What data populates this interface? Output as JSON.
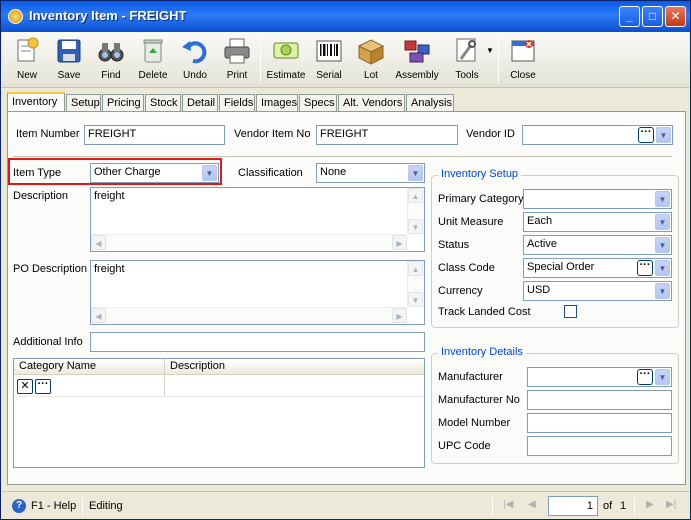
{
  "window": {
    "title": "Inventory Item - FREIGHT",
    "controls": {
      "minimize": "_",
      "maximize": "□",
      "close": "✕"
    }
  },
  "toolbar": {
    "buttons": [
      {
        "label": "New",
        "icon": "new-document-icon"
      },
      {
        "label": "Save",
        "icon": "floppy-disk-icon"
      },
      {
        "label": "Find",
        "icon": "binoculars-icon"
      },
      {
        "label": "Delete",
        "icon": "recycle-bin-icon"
      },
      {
        "label": "Undo",
        "icon": "undo-arrow-icon"
      },
      {
        "label": "Print",
        "icon": "printer-icon"
      },
      {
        "label": "Estimate",
        "icon": "estimate-icon"
      },
      {
        "label": "Serial",
        "icon": "barcode-icon"
      },
      {
        "label": "Lot",
        "icon": "box-icon"
      },
      {
        "label": "Assembly",
        "icon": "assembly-icon"
      },
      {
        "label": "Tools",
        "icon": "tools-icon"
      },
      {
        "label": "Close",
        "icon": "close-window-icon"
      }
    ]
  },
  "tabs": [
    "Inventory",
    "Setup",
    "Pricing",
    "Stock",
    "Detail",
    "Fields",
    "Images",
    "Specs",
    "Alt. Vendors",
    "Analysis"
  ],
  "active_tab": "Inventory",
  "form": {
    "item_number_label": "Item Number",
    "item_number": "FREIGHT",
    "vendor_item_no_label": "Vendor Item No",
    "vendor_item_no": "FREIGHT",
    "vendor_id_label": "Vendor ID",
    "vendor_id": "",
    "item_type_label": "Item Type",
    "item_type": "Other Charge",
    "classification_label": "Classification",
    "classification": "None",
    "description_label": "Description",
    "description": "freight",
    "po_description_label": "PO Description",
    "po_description": "freight",
    "additional_info_label": "Additional Info",
    "additional_info": ""
  },
  "category_grid": {
    "columns": [
      "Category Name",
      "Description"
    ],
    "row_delete_btn": "✕",
    "row_lookup_btn": "···"
  },
  "inventory_setup": {
    "title": "Inventory Setup",
    "primary_category_label": "Primary Category",
    "primary_category": "",
    "unit_measure_label": "Unit Measure",
    "unit_measure": "Each",
    "status_label": "Status",
    "status": "Active",
    "class_code_label": "Class Code",
    "class_code": "Special Order",
    "currency_label": "Currency",
    "currency": "USD",
    "track_landed_cost_label": "Track Landed Cost",
    "track_landed_cost": false
  },
  "inventory_details": {
    "title": "Inventory Details",
    "manufacturer_label": "Manufacturer",
    "manufacturer": "",
    "manufacturer_no_label": "Manufacturer No",
    "manufacturer_no": "",
    "model_number_label": "Model Number",
    "model_number": "",
    "upc_code_label": "UPC Code",
    "upc_code": ""
  },
  "statusbar": {
    "help": "F1 - Help",
    "status": "Editing",
    "page": "1",
    "of_label": "of",
    "total_pages": "1"
  }
}
